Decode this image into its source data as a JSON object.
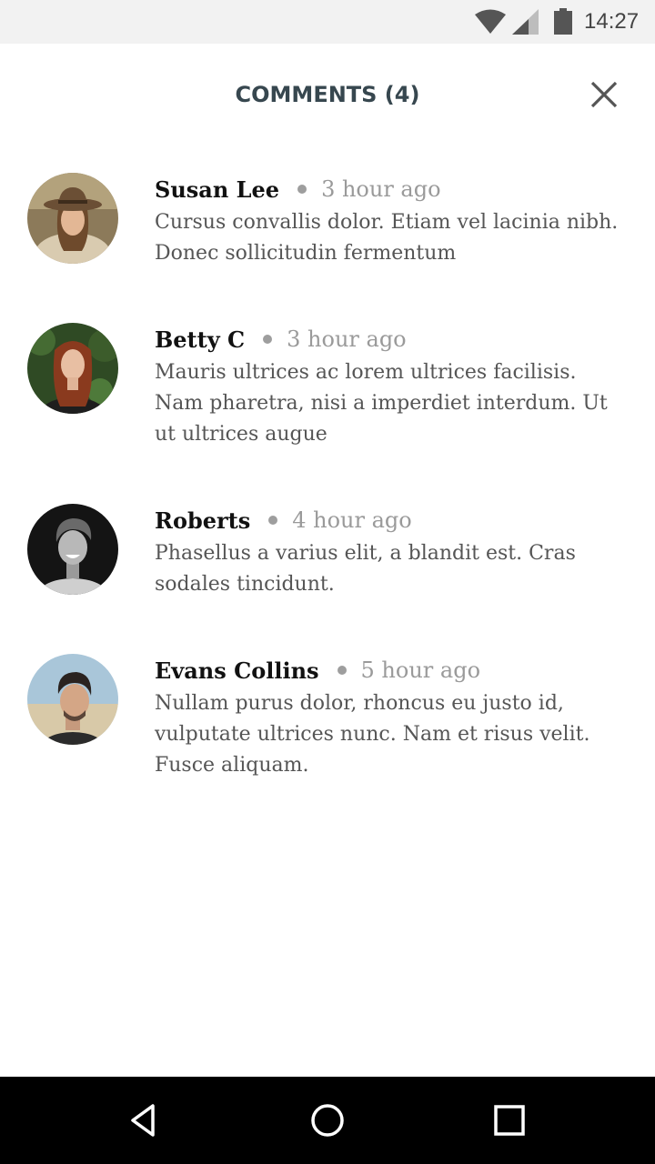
{
  "status_bar": {
    "time": "14:27",
    "icons": [
      "wifi-icon",
      "signal-icon",
      "battery-icon"
    ]
  },
  "header": {
    "title": "COMMENTS (4)",
    "close_icon": "close-icon"
  },
  "comments": [
    {
      "author": "Susan Lee",
      "time": "3 hour ago",
      "text": "Cursus convallis dolor. Etiam vel lacinia nibh. Donec sollicitudin fermentum"
    },
    {
      "author": "Betty C",
      "time": "3 hour ago",
      "text": "Mauris ultrices ac lorem ultrices facilisis. Nam pharetra, nisi a imperdiet interdum. Ut ut ultrices augue"
    },
    {
      "author": "Roberts",
      "time": "4 hour ago",
      "text": "Phasellus a varius elit, a blandit est. Cras sodales tincidunt."
    },
    {
      "author": "Evans Collins",
      "time": "5 hour ago",
      "text": "Nullam purus dolor, rhoncus eu justo id, vulputate ultrices nunc. Nam et risus velit. Fusce aliquam."
    }
  ],
  "nav_bar": {
    "buttons": [
      "back-icon",
      "home-icon",
      "recent-apps-icon"
    ]
  },
  "colors": {
    "status_bar_bg": "#f2f2f2",
    "title": "#37474f",
    "author": "#111111",
    "body_text": "#555555",
    "muted": "#9a9a9a",
    "nav_bar_bg": "#000000"
  }
}
